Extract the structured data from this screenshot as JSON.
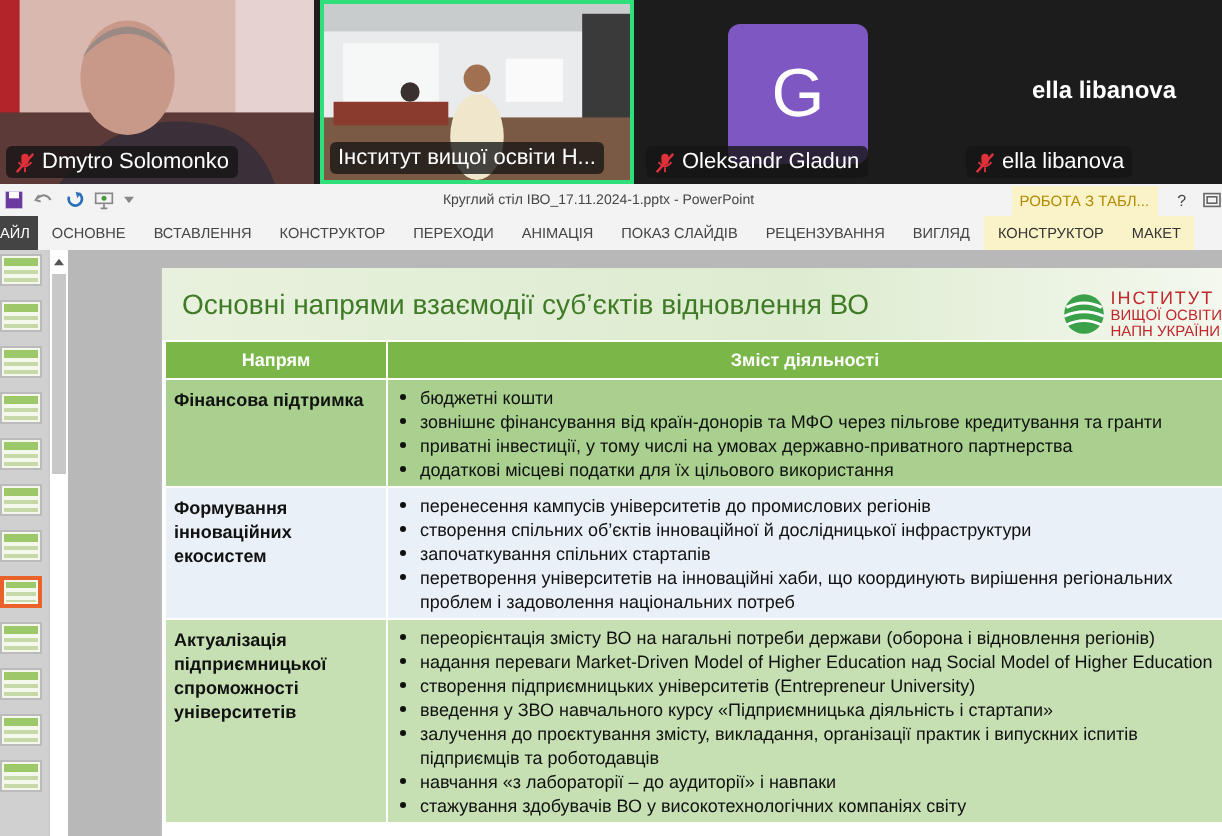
{
  "participants": [
    {
      "kind": "video",
      "name": "Dmytro Solomonko",
      "muted": true,
      "speaking": false
    },
    {
      "kind": "video",
      "name": "Інститут вищої освіти Н...",
      "muted": false,
      "speaking": true
    },
    {
      "kind": "avatar",
      "name": "Oleksandr Gladun",
      "letter": "G",
      "color": "#7e57c2",
      "muted": true,
      "speaking": false
    },
    {
      "kind": "name",
      "name": "ella libanova",
      "display": "ella libanova",
      "muted": true,
      "speaking": false
    }
  ],
  "window": {
    "title": "Круглий стіл  ІВО_17.11.2024-1.pptx - PowerPoint",
    "contextual_group": "РОБОТА З ТАБЛ...",
    "help": "?"
  },
  "ribbon_tabs": [
    {
      "label": "АЙЛ",
      "kind": "file"
    },
    {
      "label": "ОСНОВНЕ",
      "kind": "normal"
    },
    {
      "label": "ВСТАВЛЕННЯ",
      "kind": "normal"
    },
    {
      "label": "КОНСТРУКТОР",
      "kind": "normal"
    },
    {
      "label": "ПЕРЕХОДИ",
      "kind": "normal"
    },
    {
      "label": "АНІМАЦІЯ",
      "kind": "normal"
    },
    {
      "label": "ПОКАЗ СЛАЙДІВ",
      "kind": "normal"
    },
    {
      "label": "РЕЦЕНЗУВАННЯ",
      "kind": "normal"
    },
    {
      "label": "ВИГЛЯД",
      "kind": "normal"
    },
    {
      "label": "КОНСТРУКТОР",
      "kind": "contextual"
    },
    {
      "label": "МАКЕТ",
      "kind": "contextual"
    }
  ],
  "thumbnails": [
    {
      "selected": false
    },
    {
      "selected": false
    },
    {
      "selected": false
    },
    {
      "selected": false
    },
    {
      "selected": false
    },
    {
      "selected": false
    },
    {
      "selected": false
    },
    {
      "selected": true
    },
    {
      "selected": false
    },
    {
      "selected": false
    },
    {
      "selected": false
    },
    {
      "selected": false
    }
  ],
  "slide": {
    "title": "Основні напрями взаємодії суб’єктів відновлення ВО",
    "logo": [
      "ІНСТИТУТ",
      "ВИЩОЇ ОСВІТИ",
      "НАПН УКРАЇНИ"
    ],
    "table": {
      "columns": [
        "Напрям",
        "Зміст діяльності"
      ],
      "rows": [
        {
          "direction": "Фінансова підтримка",
          "items": [
            "бюджетні кошти",
            "зовнішнє фінансування від країн-донорів та МФО через пільгове  кредитування та гранти",
            "приватні інвестиції, у тому числі на умовах державно-приватного партнерства",
            "додаткові місцеві податки для їх цільового використання"
          ]
        },
        {
          "direction": "Формування інноваційних екосистем",
          "items": [
            "перенесення кампусів університетів до промислових регіонів",
            "створення спільних об’єктів інноваційної й дослідницької інфраструктури",
            "започаткування спільних стартапів",
            "перетворення університетів на інноваційні хаби, що координують  вирішення регіональних проблем і задоволення національних потреб"
          ]
        },
        {
          "direction": "Актуалізація підприємницької спроможності університетів",
          "items": [
            "переорієнтація змісту ВО на нагальні потреби держави (оборона і відновлення регіонів)",
            "надання переваги Market-Driven Model of Higher Education над Social Model of Higher Education",
            "створення підприємницьких університетів (Entrepreneur University)",
            "введення у ЗВО навчального курсу «Підприємницька діяльність і стартапи»",
            "залучення до проєктування змісту, викладання, організації практик і випускних іспитів підприємців та роботодавців",
            "навчання «з лабораторії – до аудиторії» і навпаки",
            "стажування здобувачів ВО у високотехнологічних компаніях світу"
          ]
        }
      ]
    }
  }
}
